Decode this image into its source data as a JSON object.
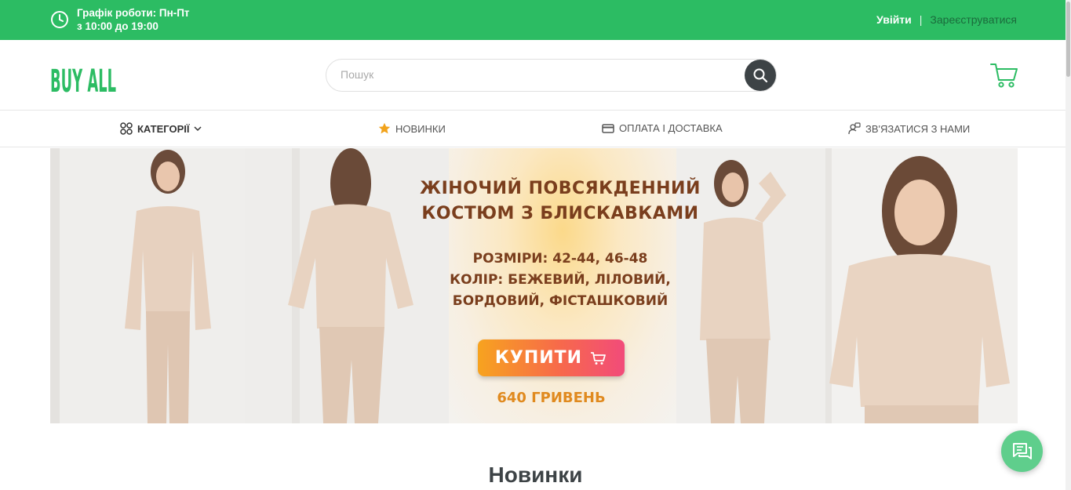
{
  "topbar": {
    "schedule_line1": "Графік роботи: Пн-Пт",
    "schedule_line2": "з 10:00 до 19:00",
    "login": "Увійти",
    "separator": "|",
    "register": "Зареєструватися"
  },
  "header": {
    "logo_text": "BUY ALL",
    "search_placeholder": "Пошук",
    "search_value": ""
  },
  "nav": {
    "categories": "КАТЕГОРІЇ",
    "news": "НОВИНКИ",
    "payment": "ОПЛАТА І ДОСТАВКА",
    "contact": "ЗВ'ЯЗАТИСЯ З НАМИ"
  },
  "banner": {
    "title_line1": "ЖІНОЧИЙ ПОВСЯКДЕННИЙ",
    "title_line2": "КОСТЮМ З БЛИСКАВКАМИ",
    "sizes": "РОЗМІРИ: 42-44, 46-48",
    "colors_line1": "КОЛІР: БЕЖЕВИЙ, ЛІЛОВИЙ,",
    "colors_line2": "БОРДОВИЙ, ФІСТАШКОВИЙ",
    "buy_label": "КУПИТИ",
    "price": "640 ГРИВЕНЬ"
  },
  "section": {
    "title": "Новинки"
  },
  "colors": {
    "brand_green": "#2cbc63",
    "dark": "#3d4346",
    "banner_text": "#7a3e1d",
    "chat": "#5fce8c"
  }
}
